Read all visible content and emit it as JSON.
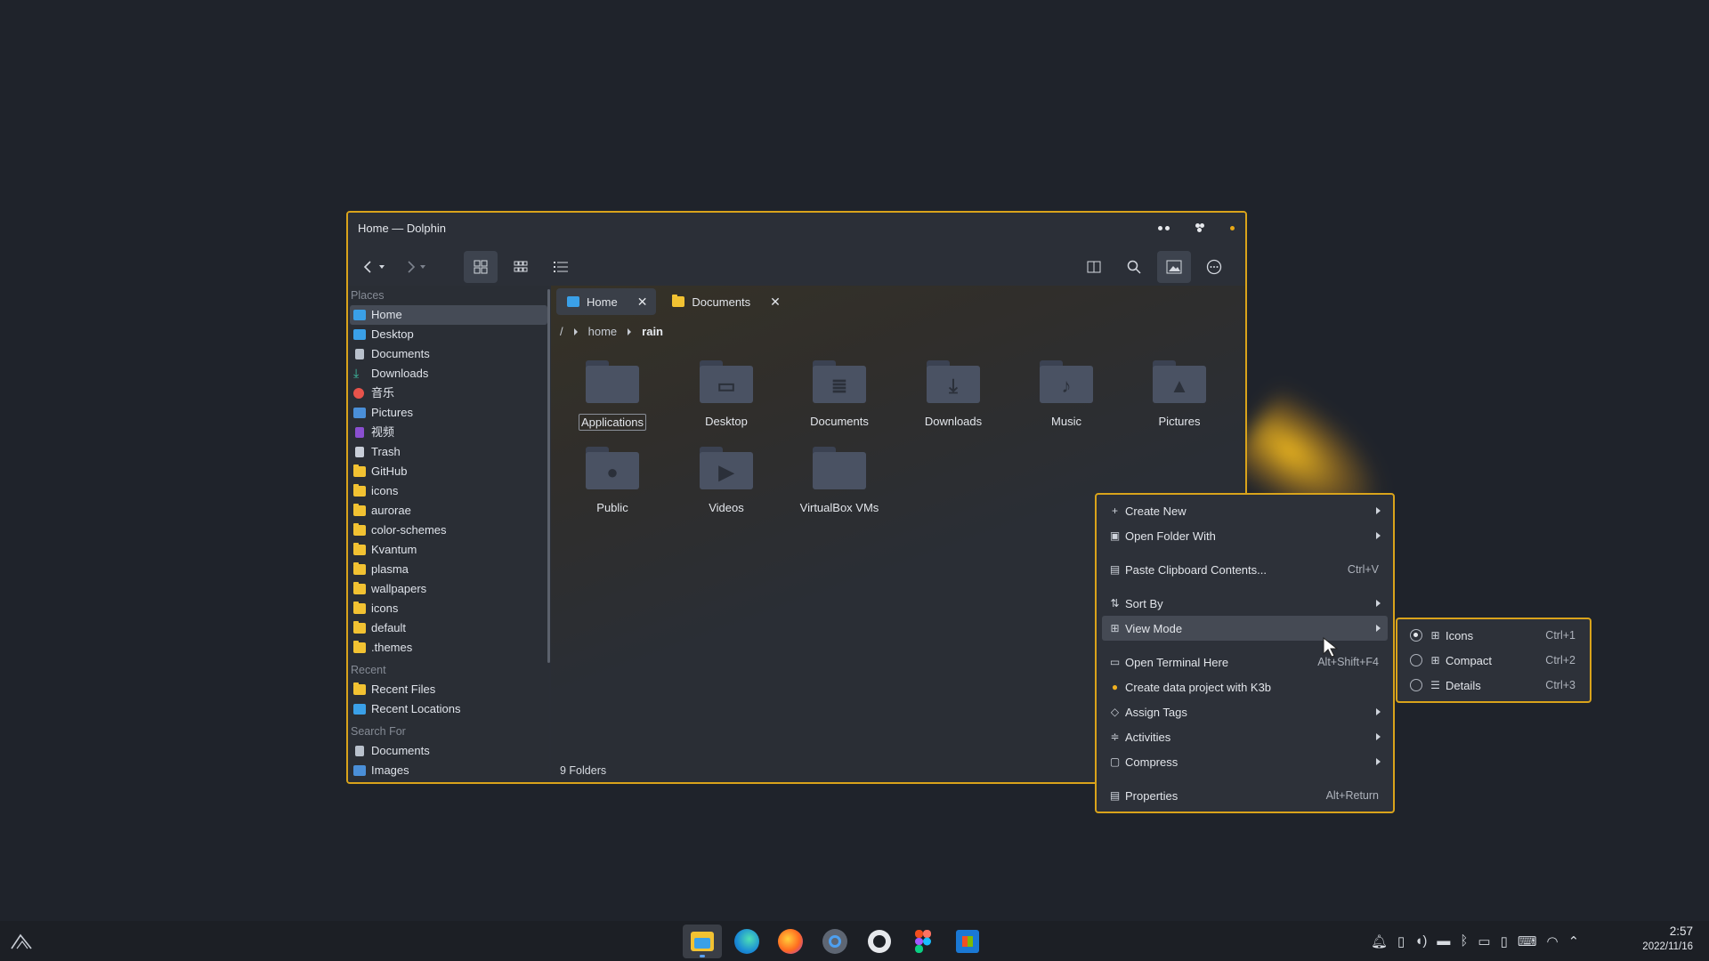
{
  "window": {
    "title": "Home — Dolphin"
  },
  "toolbar": {
    "back": "back-icon",
    "forward": "forward-icon",
    "view_icons": "icons-view-icon",
    "view_compact": "compact-view-icon",
    "view_details": "details-view-icon",
    "split": "split-icon",
    "search": "search-icon",
    "preview": "preview-icon",
    "menu": "more-icon"
  },
  "sidebar": {
    "places_header": "Places",
    "places": [
      {
        "label": "Home",
        "icon": "home-icon",
        "selected": true
      },
      {
        "label": "Desktop",
        "icon": "desktop-icon"
      },
      {
        "label": "Documents",
        "icon": "documents-icon"
      },
      {
        "label": "Downloads",
        "icon": "download-icon"
      },
      {
        "label": "音乐",
        "icon": "music-icon"
      },
      {
        "label": "Pictures",
        "icon": "pictures-icon"
      },
      {
        "label": "视频",
        "icon": "video-icon"
      },
      {
        "label": "Trash",
        "icon": "trash-icon"
      },
      {
        "label": "GitHub",
        "icon": "folder-icon"
      },
      {
        "label": "icons",
        "icon": "folder-icon"
      },
      {
        "label": "aurorae",
        "icon": "folder-icon"
      },
      {
        "label": "color-schemes",
        "icon": "folder-icon"
      },
      {
        "label": "Kvantum",
        "icon": "folder-icon"
      },
      {
        "label": "plasma",
        "icon": "folder-icon"
      },
      {
        "label": "wallpapers",
        "icon": "folder-icon"
      },
      {
        "label": "icons",
        "icon": "folder-icon"
      },
      {
        "label": "default",
        "icon": "folder-icon"
      },
      {
        "label": ".themes",
        "icon": "folder-icon"
      }
    ],
    "recent_header": "Recent",
    "recent": [
      {
        "label": "Recent Files"
      },
      {
        "label": "Recent Locations"
      }
    ],
    "search_header": "Search For",
    "search": [
      {
        "label": "Documents"
      },
      {
        "label": "Images"
      }
    ]
  },
  "tabs": [
    {
      "label": "Home",
      "active": true
    },
    {
      "label": "Documents",
      "active": false
    }
  ],
  "breadcrumb": {
    "root": "/",
    "parts": [
      "home",
      "rain"
    ]
  },
  "folders": [
    {
      "label": "Applications",
      "glyph": "",
      "selected": true
    },
    {
      "label": "Desktop",
      "glyph": "▭"
    },
    {
      "label": "Documents",
      "glyph": "≣"
    },
    {
      "label": "Downloads",
      "glyph": "⤓"
    },
    {
      "label": "Music",
      "glyph": "♪"
    },
    {
      "label": "Pictures",
      "glyph": "▲"
    },
    {
      "label": "Public",
      "glyph": "●"
    },
    {
      "label": "Videos",
      "glyph": "▶"
    },
    {
      "label": "VirtualBox VMs",
      "glyph": ""
    }
  ],
  "status": {
    "text": "9 Folders"
  },
  "context_menu": {
    "items": [
      {
        "label": "Create New",
        "icon": "plus-icon",
        "submenu": true
      },
      {
        "label": "Open Folder With",
        "icon": "open-with-icon",
        "submenu": true
      },
      {
        "separator": true
      },
      {
        "label": "Paste Clipboard Contents...",
        "icon": "paste-icon",
        "shortcut": "Ctrl+V"
      },
      {
        "separator": true
      },
      {
        "label": "Sort By",
        "icon": "sort-icon",
        "submenu": true
      },
      {
        "label": "View Mode",
        "icon": "view-mode-icon",
        "submenu": true,
        "highlighted": true
      },
      {
        "separator": true
      },
      {
        "label": "Open Terminal Here",
        "icon": "terminal-icon",
        "shortcut": "Alt+Shift+F4"
      },
      {
        "label": "Create data project with K3b",
        "icon": "k3b-icon"
      },
      {
        "label": "Assign Tags",
        "icon": "tag-icon",
        "submenu": true
      },
      {
        "label": "Activities",
        "icon": "activities-icon",
        "submenu": true
      },
      {
        "label": "Compress",
        "icon": "compress-icon",
        "submenu": true
      },
      {
        "separator": true
      },
      {
        "label": "Properties",
        "icon": "properties-icon",
        "shortcut": "Alt+Return"
      }
    ]
  },
  "view_submenu": {
    "items": [
      {
        "label": "Icons",
        "shortcut": "Ctrl+1",
        "checked": true
      },
      {
        "label": "Compact",
        "shortcut": "Ctrl+2",
        "checked": false
      },
      {
        "label": "Details",
        "shortcut": "Ctrl+3",
        "checked": false
      }
    ]
  },
  "taskbar": {
    "apps": [
      "dolphin-icon",
      "edge-icon",
      "firefox-icon",
      "settings-icon",
      "github-icon",
      "figma-icon",
      "store-icon"
    ],
    "tray": [
      "bell-icon",
      "clipboard-icon",
      "volume-icon",
      "battery-icon",
      "bluetooth-icon",
      "display-icon",
      "phone-icon",
      "keyboard-icon",
      "wifi-icon",
      "chevron-up-icon"
    ],
    "time": "2:57",
    "date": "2022/11/16"
  },
  "colors": {
    "accent": "#d9a31b",
    "folder": "#f2c232",
    "background": "#1f232b"
  }
}
